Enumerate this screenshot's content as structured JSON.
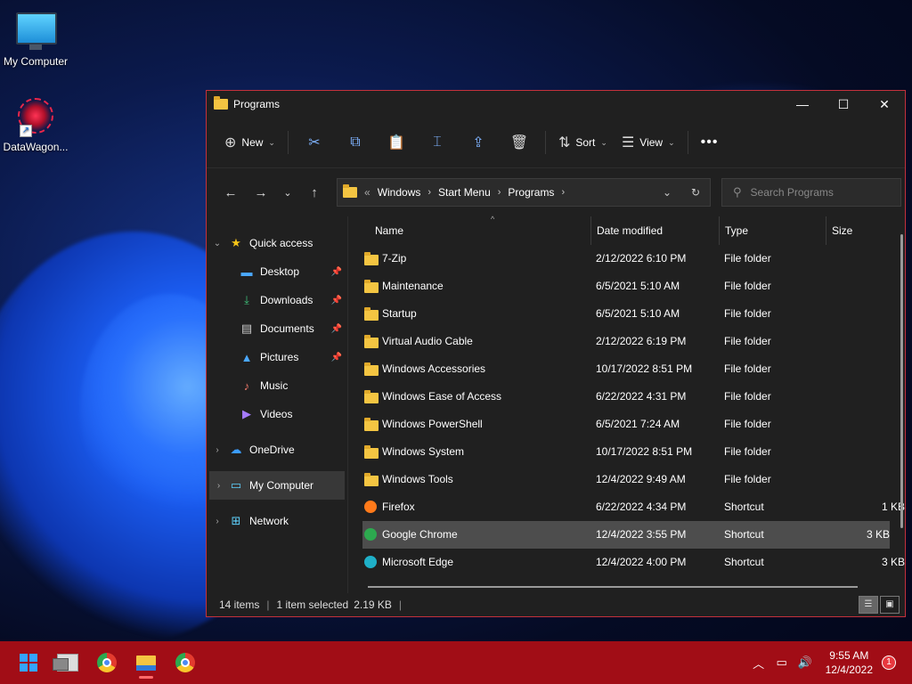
{
  "desktop": {
    "icons": [
      {
        "label": "My Computer"
      },
      {
        "label": "DataWagon..."
      }
    ]
  },
  "window": {
    "title": "Programs",
    "toolbar": {
      "new_label": "New",
      "sort_label": "Sort",
      "view_label": "View"
    },
    "address": {
      "prefix": "«",
      "crumbs": [
        "Windows",
        "Start Menu",
        "Programs"
      ]
    },
    "search_placeholder": "Search Programs",
    "navpane": {
      "quick_access": "Quick access",
      "pinned": [
        "Desktop",
        "Downloads",
        "Documents",
        "Pictures"
      ],
      "unpinned": [
        "Music",
        "Videos"
      ],
      "onedrive": "OneDrive",
      "my_computer": "My Computer",
      "network": "Network"
    },
    "columns": {
      "name": "Name",
      "date": "Date modified",
      "type": "Type",
      "size": "Size"
    },
    "files": [
      {
        "name": "7-Zip",
        "date": "2/12/2022 6:10 PM",
        "type": "File folder",
        "size": ""
      },
      {
        "name": "Maintenance",
        "date": "6/5/2021 5:10 AM",
        "type": "File folder",
        "size": ""
      },
      {
        "name": "Startup",
        "date": "6/5/2021 5:10 AM",
        "type": "File folder",
        "size": ""
      },
      {
        "name": "Virtual Audio Cable",
        "date": "2/12/2022 6:19 PM",
        "type": "File folder",
        "size": ""
      },
      {
        "name": "Windows Accessories",
        "date": "10/17/2022 8:51 PM",
        "type": "File folder",
        "size": ""
      },
      {
        "name": "Windows Ease of Access",
        "date": "6/22/2022 4:31 PM",
        "type": "File folder",
        "size": ""
      },
      {
        "name": "Windows PowerShell",
        "date": "6/5/2021 7:24 AM",
        "type": "File folder",
        "size": ""
      },
      {
        "name": "Windows System",
        "date": "10/17/2022 8:51 PM",
        "type": "File folder",
        "size": ""
      },
      {
        "name": "Windows Tools",
        "date": "12/4/2022 9:49 AM",
        "type": "File folder",
        "size": ""
      },
      {
        "name": "Firefox",
        "date": "6/22/2022 4:34 PM",
        "type": "Shortcut",
        "size": "1 KB"
      },
      {
        "name": "Google Chrome",
        "date": "12/4/2022 3:55 PM",
        "type": "Shortcut",
        "size": "3 KB"
      },
      {
        "name": "Microsoft Edge",
        "date": "12/4/2022 4:00 PM",
        "type": "Shortcut",
        "size": "3 KB"
      }
    ],
    "status": {
      "items": "14 items",
      "selected": "1 item selected",
      "selected_size": "2.19 KB"
    }
  },
  "taskbar": {
    "time": "9:55 AM",
    "date": "12/4/2022",
    "notification_count": "1"
  },
  "colors": {
    "taskbar": "#a10d16",
    "window_border": "#c4313c",
    "window_bg": "#202020",
    "selection": "#4d4d4d"
  }
}
